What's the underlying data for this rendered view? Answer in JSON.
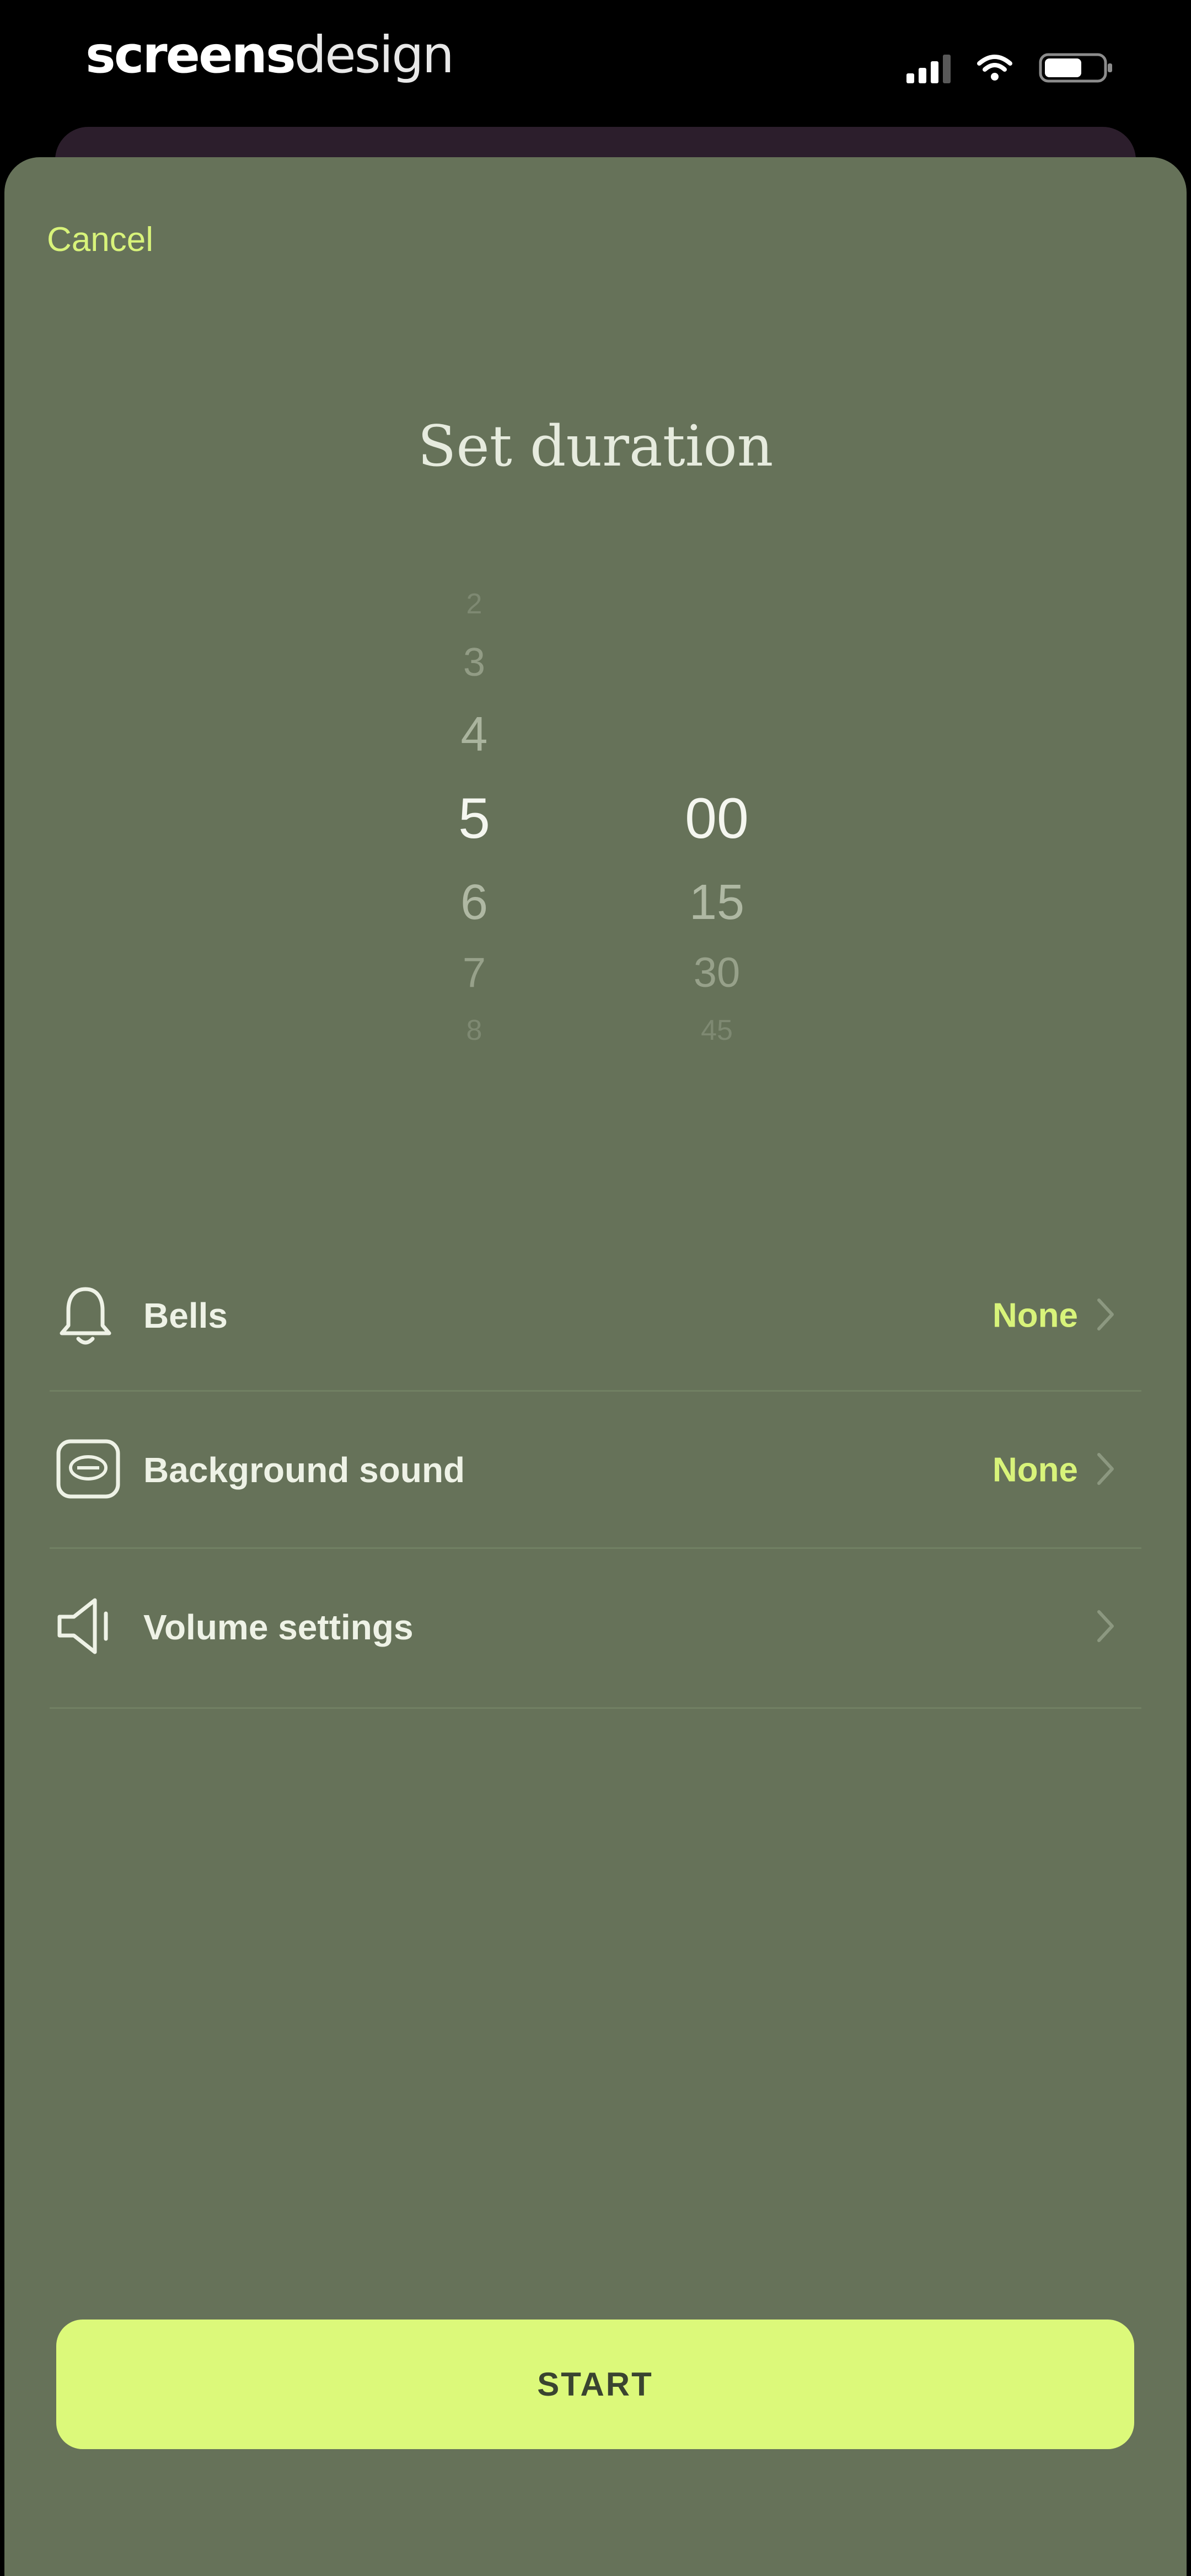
{
  "status_bar": {
    "brand_bold": "screens",
    "brand_light": "design",
    "icons": [
      "cellular-signal-icon",
      "wifi-icon",
      "battery-icon"
    ]
  },
  "sheet": {
    "cancel_label": "Cancel",
    "title": "Set duration",
    "background_color": "#667259",
    "accent_color": "#d8f37a"
  },
  "picker": {
    "minutes": [
      "2",
      "3",
      "4",
      "5",
      "6",
      "7",
      "8"
    ],
    "selected_minutes": "5",
    "seconds": [
      "00",
      "15",
      "30",
      "45"
    ],
    "selected_seconds": "00"
  },
  "settings": {
    "bells": {
      "label": "Bells",
      "value": "None",
      "icon": "bell-icon"
    },
    "background_sound": {
      "label": "Background sound",
      "value": "None",
      "icon": "radio-icon"
    },
    "volume": {
      "label": "Volume settings",
      "icon": "speaker-icon"
    }
  },
  "start_label": "START"
}
